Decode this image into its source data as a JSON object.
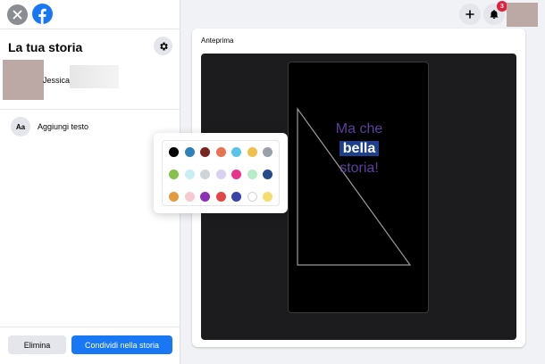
{
  "sidebar": {
    "title": "La tua storia",
    "profile_name": "Jessica",
    "add_text_icon": "Aa",
    "add_text_label": "Aggiungi testo",
    "delete_label": "Elimina",
    "share_label": "Condividi nella storia"
  },
  "header": {
    "notification_count": "3"
  },
  "preview": {
    "label": "Anteprima",
    "text_line1": "Ma che",
    "text_highlight": "bella",
    "text_line3": "storia!"
  },
  "icons": {
    "close": "close-icon",
    "logo": "facebook-logo-icon",
    "settings": "gear-icon",
    "add": "plus-icon",
    "notifications": "bell-icon"
  },
  "colors": {
    "accent": "#1877f2",
    "story_text": "#5b3f9e",
    "highlight": "#1d3f8c",
    "palette": [
      [
        "#000000",
        "#2f81b8",
        "#7a2422",
        "#e8734f",
        "#5ac3ea",
        "#efc04c",
        "#9aa1a8"
      ],
      [
        "#86c14c",
        "#c8eef3",
        "#cfd4d9",
        "#d8d2f0",
        "#e8348c",
        "#b6ecc9",
        "#244a8a"
      ],
      [
        "#e39a3c",
        "#f5cad2",
        "#8c2fb5",
        "#e34446",
        "#3943a8",
        "#ffffff",
        "#f6dd6f"
      ]
    ]
  }
}
